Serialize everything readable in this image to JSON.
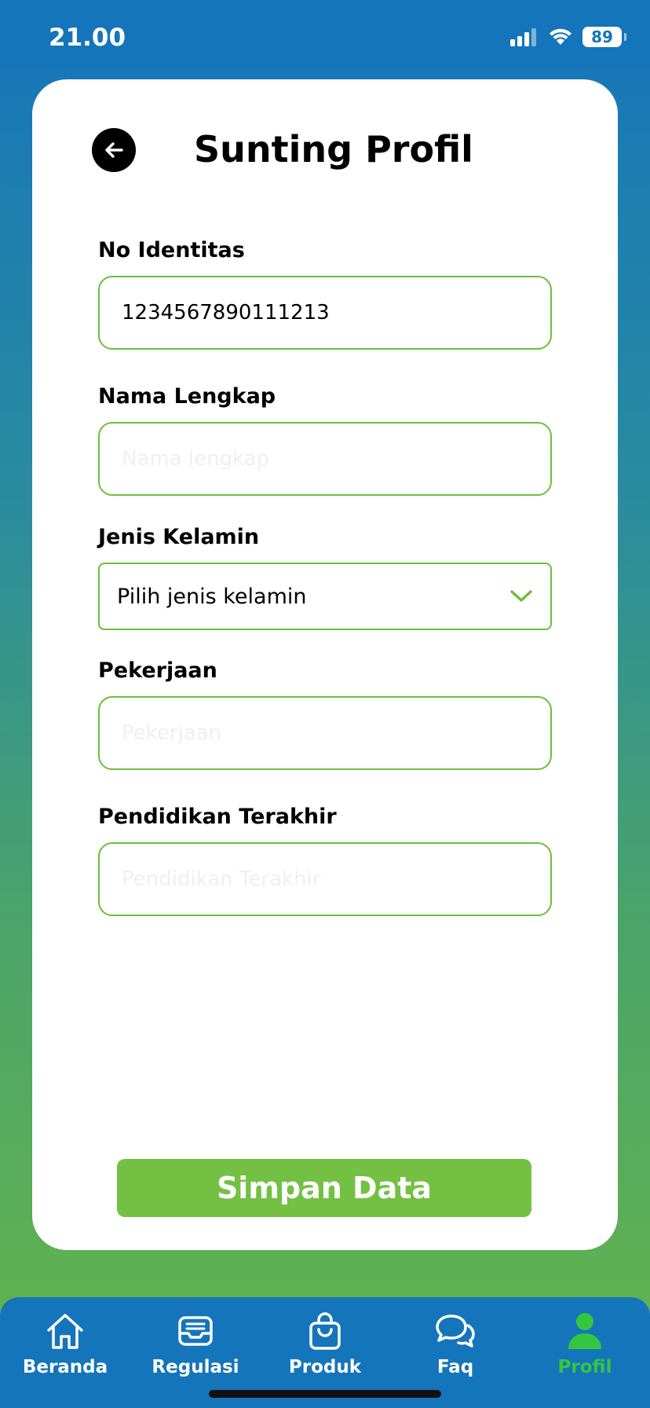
{
  "status_bar": {
    "time": "21.00",
    "battery": "89"
  },
  "header": {
    "title": "Sunting Profil"
  },
  "form": {
    "id_number": {
      "label": "No Identitas",
      "value": "1234567890111213",
      "placeholder": ""
    },
    "full_name": {
      "label": "Nama Lengkap",
      "value": "",
      "placeholder": "Nama lengkap"
    },
    "gender": {
      "label": "Jenis Kelamin",
      "selected": "Pilih jenis kelamin"
    },
    "occupation": {
      "label": "Pekerjaan",
      "value": "",
      "placeholder": "Pekerjaan"
    },
    "education": {
      "label": "Pendidikan Terakhir",
      "value": "",
      "placeholder": "Pendidikan Terakhir"
    }
  },
  "save_button": {
    "label": "Simpan Data"
  },
  "tabs": [
    {
      "label": "Beranda",
      "icon": "home-icon",
      "active": false
    },
    {
      "label": "Regulasi",
      "icon": "inbox-icon",
      "active": false
    },
    {
      "label": "Produk",
      "icon": "shopping-bag-icon",
      "active": false
    },
    {
      "label": "Faq",
      "icon": "chat-bubbles-icon",
      "active": false
    },
    {
      "label": "Profil",
      "icon": "user-icon",
      "active": true
    }
  ],
  "colors": {
    "primary_blue": "#1575bb",
    "accent_green": "#73c043",
    "active_tab": "#35c640",
    "field_border": "#6cbf3b"
  }
}
